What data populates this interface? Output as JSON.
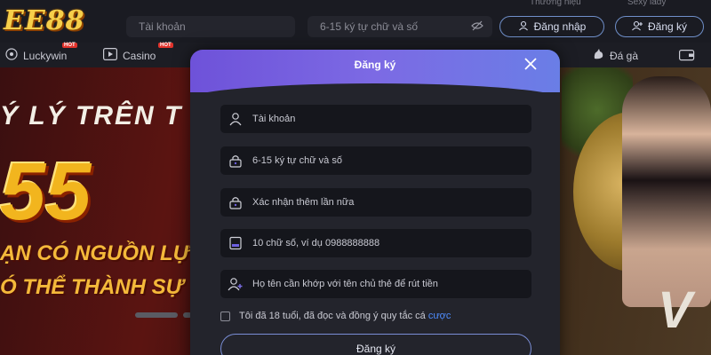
{
  "header": {
    "logo": "EE88",
    "username_placeholder": "Tài khoản",
    "password_placeholder": "6-15 ký tự chữ và số",
    "login_label": "Đăng nhập",
    "register_label": "Đăng ký",
    "top_hints": [
      "Thương hiệu",
      "Sexy lady"
    ]
  },
  "nav": {
    "items": [
      {
        "label": "Luckywin",
        "icon": "soccer-ball-icon",
        "hot": "HOT"
      },
      {
        "label": "Casino",
        "icon": "play-icon",
        "hot": "HOT"
      },
      {
        "label": "Đá gà",
        "icon": "rooster-icon"
      }
    ]
  },
  "banner": {
    "line1": "Ý LÝ TRÊN T",
    "big": "55",
    "line2": "ẠN CÓ NGUỒN LỰC, C",
    "line3": "Ó THỂ THÀNH SỰ",
    "right_logo": "V"
  },
  "modal": {
    "title": "Đăng ký",
    "close_icon": "close-icon",
    "fields": [
      {
        "placeholder": "Tài khoản",
        "icon": "user-icon"
      },
      {
        "placeholder": "6-15 ký tự chữ và số",
        "icon": "lock-icon"
      },
      {
        "placeholder": "Xác nhận thêm lần nữa",
        "icon": "lock-icon"
      },
      {
        "placeholder": "10 chữ số, ví dụ 0988888888",
        "icon": "phone-icon"
      },
      {
        "placeholder": "Họ tên cần khớp với tên chủ thẻ để rút tiền",
        "icon": "user-add-icon"
      }
    ],
    "agree_text": "Tôi đã 18 tuổi, đã đọc và đồng ý quy tắc cá",
    "agree_link": "cược",
    "submit_label": "Đăng ký"
  },
  "colors": {
    "accent_purple": "#6e52d9",
    "link_blue": "#4f8dff",
    "logo_gold": "#f6cf4a"
  }
}
